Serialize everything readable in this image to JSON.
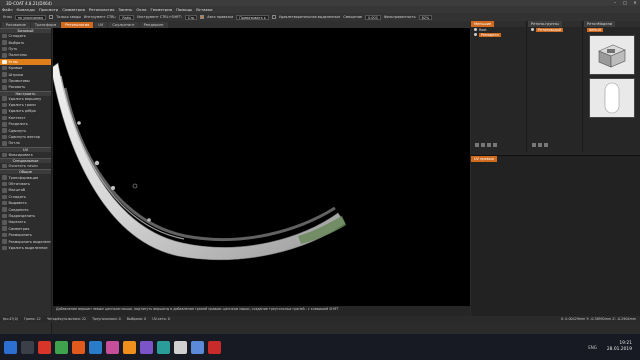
{
  "window": {
    "title": "3D-COAT 4.8.21(DX64)",
    "controls": [
      "–",
      "□",
      "✕"
    ]
  },
  "menu": [
    "Файл",
    "Команды",
    "Просмотр",
    "Симметрия",
    "Ретопология",
    "Запечь",
    "Окна",
    "Геометрия",
    "Помощь",
    "Вставки"
  ],
  "options": {
    "t1": "Углы",
    "t2": "по умолчанию",
    "t3": "Только квады",
    "t4": "Инструмент CTRL:",
    "t4v": "Ratio",
    "t5": "Инструмент CTRL+SHIFT:",
    "t5v": "Стр",
    "t6": "Авто привязка",
    "t7": "Привязывать к",
    "t8": "Удовлетворительная выделенные",
    "t9": "Смещение",
    "t9v": "0.000",
    "t10": "Фильтрованность",
    "t10v": "62%",
    "t11": "Игнорировать зеркало",
    "t12": "Привязка к зеркалу",
    "t12v": "44%",
    "t13": "Цвета"
  },
  "tabs": [
    "Рисование",
    "Трансформ",
    "Ретопология",
    "UV",
    "Скульптинг",
    "Рендеринг"
  ],
  "tabs_active_index": 2,
  "left": {
    "sec_basic": "Базовый",
    "basic": [
      "Сгладить",
      "Выбрать",
      "Путь",
      "Полигоны",
      "Углы",
      "Кривые",
      "Штрихи",
      "Примитивы",
      "Рисовать"
    ],
    "basic_active_index": 4,
    "sec_setup": "Настроить",
    "setup": [
      "Удалить вершину",
      "Удалить грани",
      "Удалить рёбра",
      "Контекст",
      "Разделить",
      "Сдвинуть",
      "Сдвинуть вектор",
      "Петля"
    ],
    "sec_uv": "UV",
    "uv": [
      "Фиксировать"
    ],
    "sec_special": "Специальные",
    "special": [
      "Очистить точки"
    ],
    "sec_common": "Общие",
    "common": [
      "Трансформация",
      "Обтягивать",
      "Масштаб",
      "Сгладить",
      "Выдавить",
      "Соединить",
      "Подразделить",
      "Нарезать",
      "Симметрия",
      "Разморозить",
      "Разморозить выделенное",
      "Удалить выделенное"
    ]
  },
  "panels": {
    "layers_tab": "Меньшие",
    "groups_tab": "Ретопо-группы",
    "model_tab": "РетопМодели",
    "layer_root": "Root",
    "layer_item": "Ремоделл",
    "group_item": "Ретоповодой",
    "model_item": "default",
    "uv_tab": "UV превью"
  },
  "statusline": "Добавление вершин левым щелчком мыши, подтянуть вершины в добавление граней правым щелчком мыши, создание треугольных граней - с клавишей SHIFT",
  "status": {
    "fps": "fps:47(0)",
    "verts": "Грани: 22",
    "quads": "Четырёхугольники: 22",
    "tris": "Треугольники: 0",
    "selected": "Выбрано: 0",
    "memory": "UV-сеть: 0",
    "coords": "X: 0.00429mm  Y: -0.38992mm  Z: -0.2904mm"
  },
  "taskbar": {
    "time": "19:21",
    "date": "28.01.2019",
    "lang": "ENG"
  }
}
